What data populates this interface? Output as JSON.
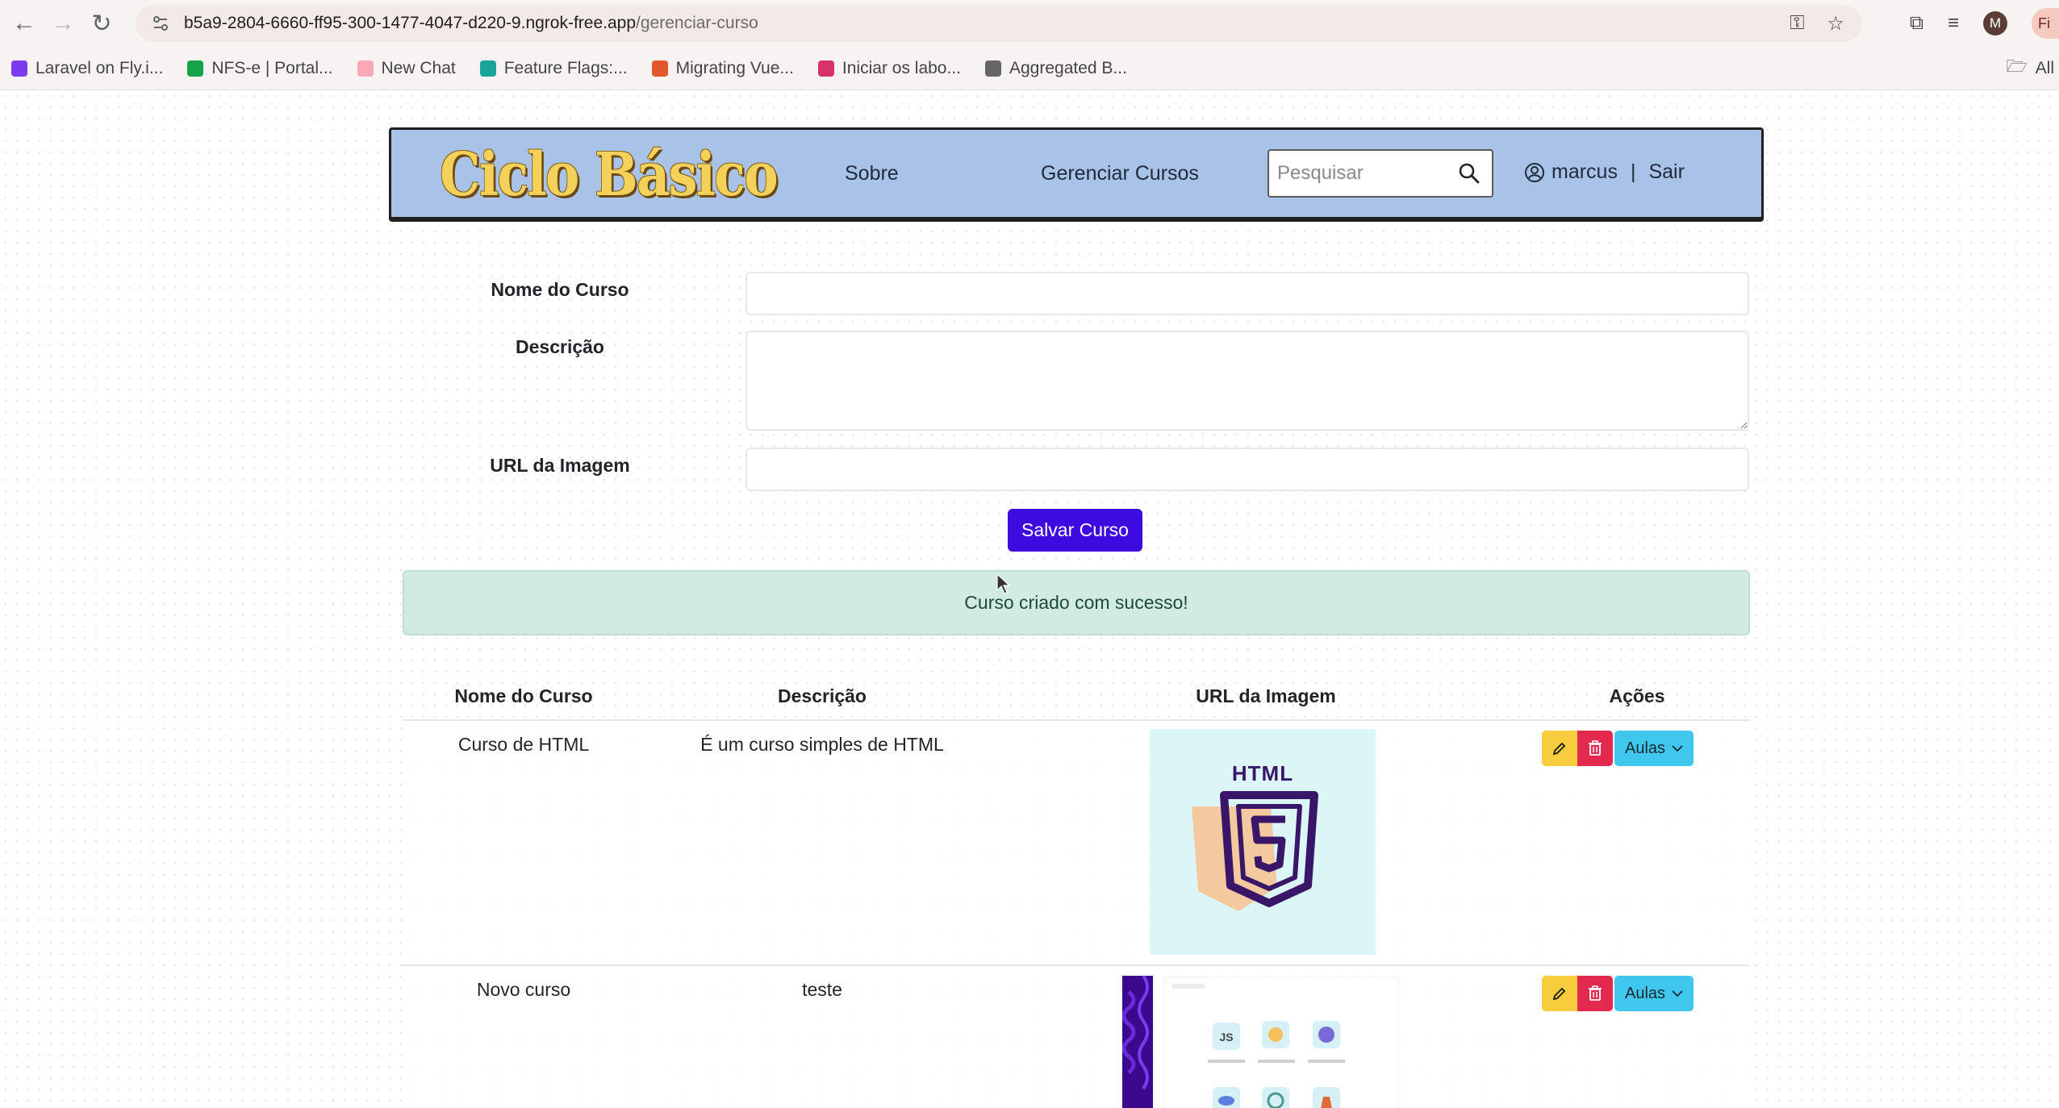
{
  "browser": {
    "url_host": "b5a9-2804-6660-ff95-300-1477-4047-d220-9.ngrok-free.app",
    "url_path": "/gerenciar-curso",
    "profile_initial": "M",
    "profile_pill_text": "Fi",
    "bookmarks": [
      {
        "label": "Laravel on Fly.i...",
        "color": "#7c3aed"
      },
      {
        "label": "NFS-e | Portal...",
        "color": "#16a34a"
      },
      {
        "label": "New Chat",
        "color": "#f9a8b5"
      },
      {
        "label": "Feature Flags:...",
        "color": "#1aa39a"
      },
      {
        "label": "Migrating Vue...",
        "color": "#e2572c"
      },
      {
        "label": "Iniciar os labo...",
        "color": "#d6336c"
      },
      {
        "label": "Aggregated B...",
        "color": "#666666"
      }
    ],
    "all_bookmarks_label": "All"
  },
  "header": {
    "logo_text": "Ciclo Básico",
    "nav_sobre": "Sobre",
    "nav_gerenciar": "Gerenciar Cursos",
    "search_placeholder": "Pesquisar",
    "username": "marcus",
    "separator": "|",
    "logout": "Sair"
  },
  "form": {
    "nome_label": "Nome do Curso",
    "nome_value": "",
    "descricao_label": "Descrição",
    "descricao_value": "",
    "url_label": "URL da Imagem",
    "url_value": "",
    "save_button": "Salvar Curso"
  },
  "alert": {
    "message": "Curso criado com sucesso!"
  },
  "table": {
    "headers": [
      "Nome do Curso",
      "Descrição",
      "URL da Imagem",
      "Ações"
    ],
    "rows": [
      {
        "nome": "Curso de HTML",
        "descricao": "É um curso simples de HTML",
        "image_label": "HTML",
        "aulas_label": "Aulas"
      },
      {
        "nome": "Novo curso",
        "descricao": "teste",
        "aulas_label": "Aulas"
      }
    ]
  },
  "colors": {
    "header_bg": "#a9c2e8",
    "primary_button": "#3d0ae0",
    "alert_bg": "#d2ebe2",
    "edit_button": "#f7cd3d",
    "delete_button": "#e4294f",
    "aulas_button": "#3fc7ee",
    "logo_color": "#f3d15b"
  }
}
